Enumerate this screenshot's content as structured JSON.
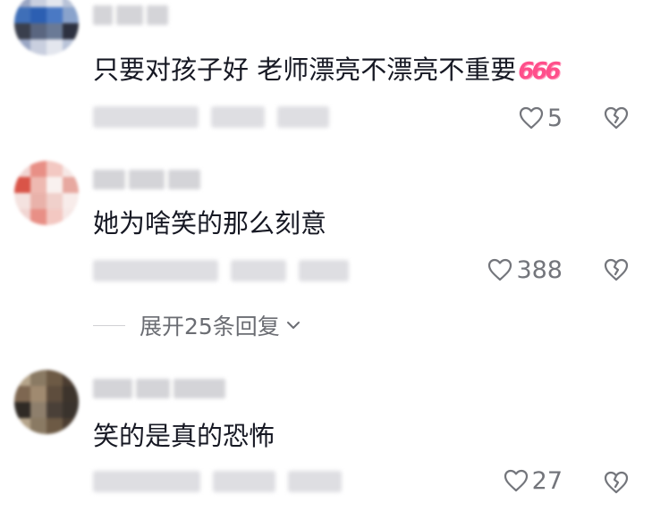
{
  "comments": [
    {
      "text": "只要对孩子好 老师漂亮不漂亮不重要",
      "emoji": "666",
      "likes": "5",
      "avatar_colors": [
        "#9aa6c4",
        "#c9cfdf",
        "#e3e6ee",
        "#b9c3d8",
        "#3f6fb8",
        "#2c5fb2",
        "#4a79c4",
        "#8aa3cc",
        "#3a3f4d",
        "#5a6680",
        "#6a7a96",
        "#2d3140"
      ]
    },
    {
      "text": "她为啥笑的那么刻意",
      "likes": "388",
      "avatar_colors": [
        "#f1d5d2",
        "#e88f86",
        "#f3c8c2",
        "#f6e8e6",
        "#d95448",
        "#eeb9b1",
        "#f9f1ef",
        "#e7a8a0",
        "#f4e2df",
        "#e9b2aa",
        "#f0d0cb",
        "#f8ecea"
      ]
    },
    {
      "text": "笑的是真的恐怖",
      "likes": "27",
      "avatar_colors": [
        "#b5a48a",
        "#8a7a63",
        "#6d5a45",
        "#4b3d31",
        "#7e6751",
        "#a08a70",
        "#5e4d3d",
        "#3d342c",
        "#2f2a25",
        "#8e7f6c",
        "#4a4038",
        "#3a332d"
      ]
    }
  ],
  "replies_label": "展开25条回复"
}
